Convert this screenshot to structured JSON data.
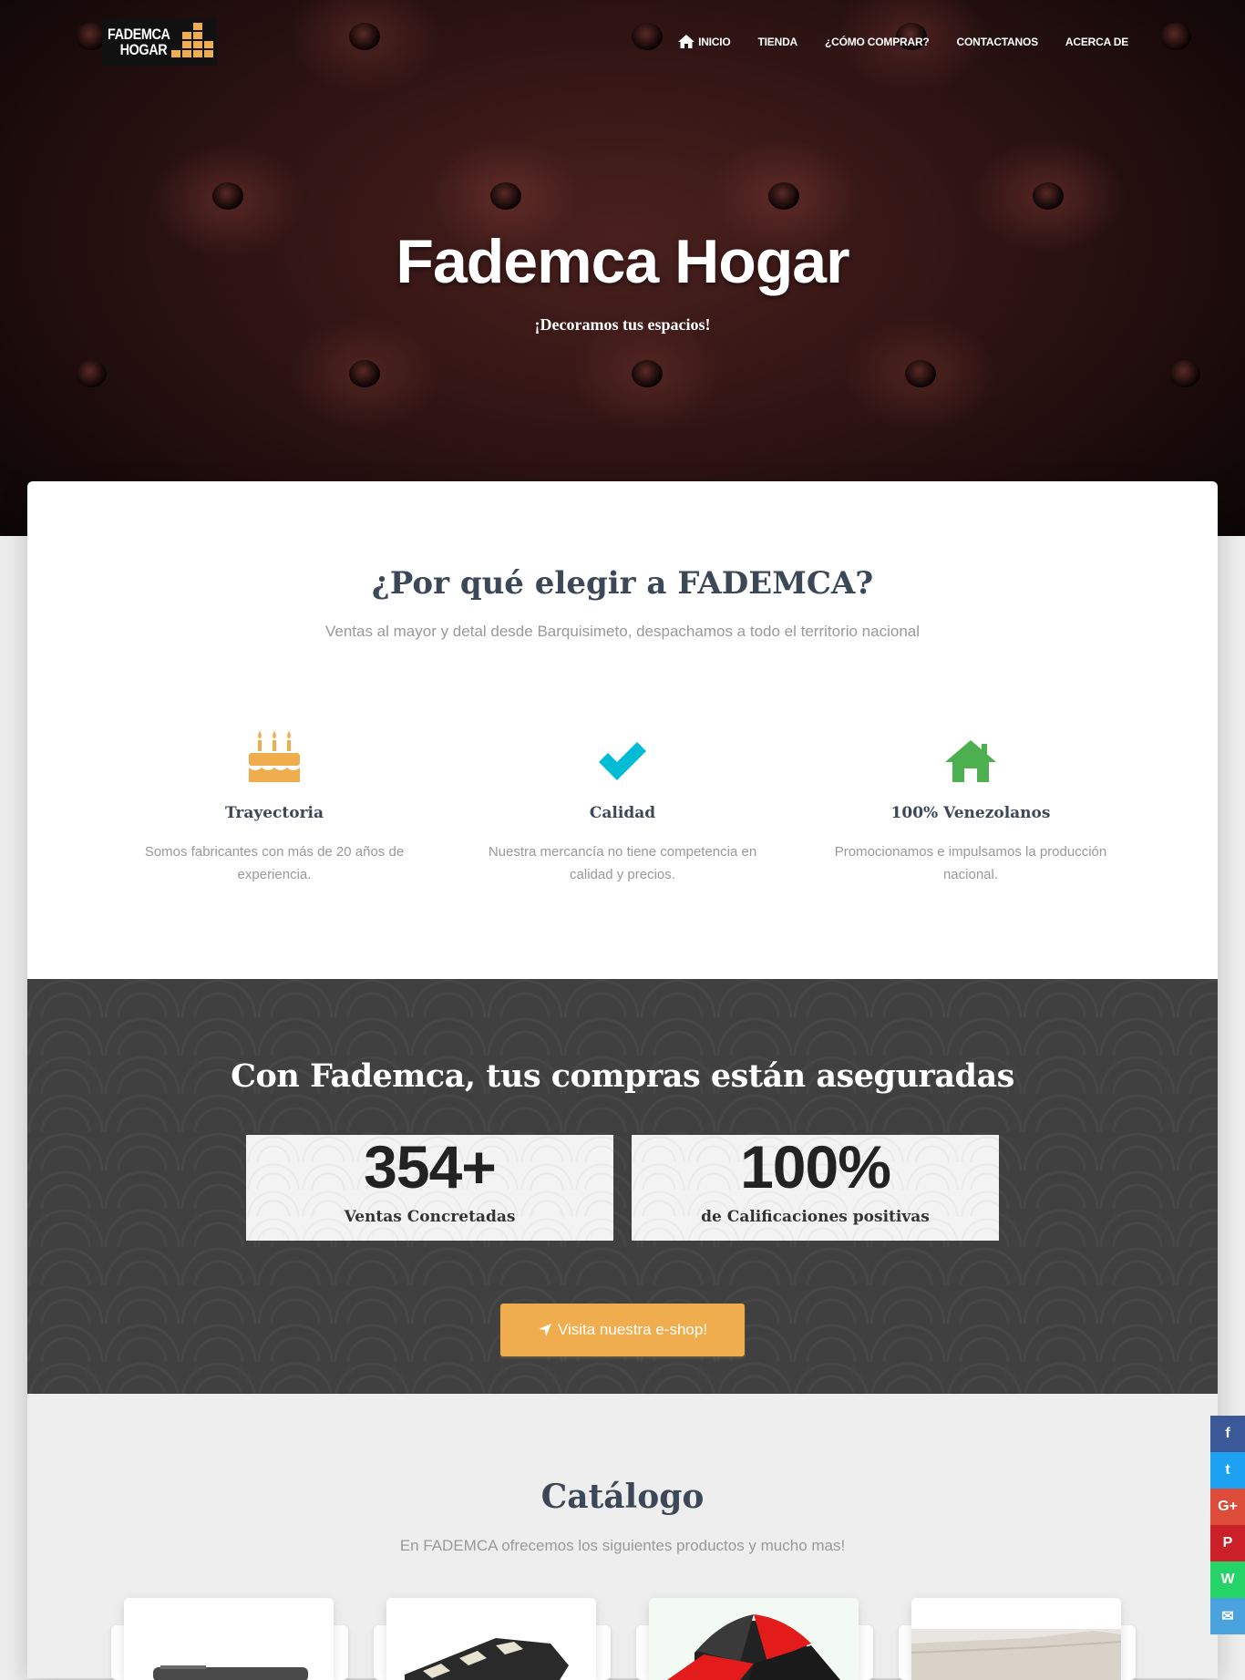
{
  "brand": {
    "logo_line1": "FADEMCA",
    "logo_line2": "HOGAR",
    "accent": "#f0ad4e"
  },
  "nav": {
    "items": [
      {
        "label": "INICIO",
        "icon": "home-icon"
      },
      {
        "label": "TIENDA"
      },
      {
        "label": "¿CÓMO COMPRAR?"
      },
      {
        "label": "CONTACTANOS"
      },
      {
        "label": "ACERCA DE"
      }
    ]
  },
  "hero": {
    "title": "Fademca Hogar",
    "subtitle": "¡Decoramos tus espacios!"
  },
  "why": {
    "title": "¿Por qué elegir a FADEMCA?",
    "subtitle": "Ventas al mayor y detal desde Barquisimeto, despachamos a todo el territorio nacional",
    "features": [
      {
        "icon": "birthday-cake-icon",
        "color": "#f0ad4e",
        "title": "Trayectoria",
        "text": "Somos fabricantes con más de 20 años de experiencia."
      },
      {
        "icon": "checkmark-icon",
        "color": "#00bcd4",
        "title": "Calidad",
        "text": "Nuestra mercancía no tiene competencia en calidad y precios."
      },
      {
        "icon": "home-icon",
        "color": "#4caf50",
        "title": "100% Venezolanos",
        "text": "Promocionamos e impulsamos la producción nacional."
      }
    ]
  },
  "stats": {
    "title": "Con Fademca, tus compras están aseguradas",
    "items": [
      {
        "value": "354+",
        "label": "Ventas Concretadas"
      },
      {
        "value": "100%",
        "label": "de Calificaciones positivas"
      }
    ],
    "cta_label": "Visita nuestra e-shop!",
    "cta_icon": "location-arrow-icon"
  },
  "catalog": {
    "title": "Catálogo",
    "subtitle": "En FADEMCA ofrecemos los siguientes productos y mucho mas!",
    "products": [
      {
        "image": "dark-sofa"
      },
      {
        "image": "checkered-sofa"
      },
      {
        "image": "red-black-ottoman"
      },
      {
        "image": "white-sectional-sofa"
      }
    ]
  },
  "social": [
    {
      "network": "facebook",
      "icon": "facebook-icon",
      "glyph": "f",
      "color": "#3b5998"
    },
    {
      "network": "twitter",
      "icon": "twitter-icon",
      "glyph": "t",
      "color": "#1da1f2"
    },
    {
      "network": "google-plus",
      "icon": "google-plus-icon",
      "glyph": "G+",
      "color": "#dd4b39"
    },
    {
      "network": "pinterest",
      "icon": "pinterest-icon",
      "glyph": "P",
      "color": "#cb2027"
    },
    {
      "network": "whatsapp",
      "icon": "whatsapp-icon",
      "glyph": "W",
      "color": "#25d366"
    },
    {
      "network": "email",
      "icon": "email-icon",
      "glyph": "✉",
      "color": "#4aa3df"
    }
  ]
}
